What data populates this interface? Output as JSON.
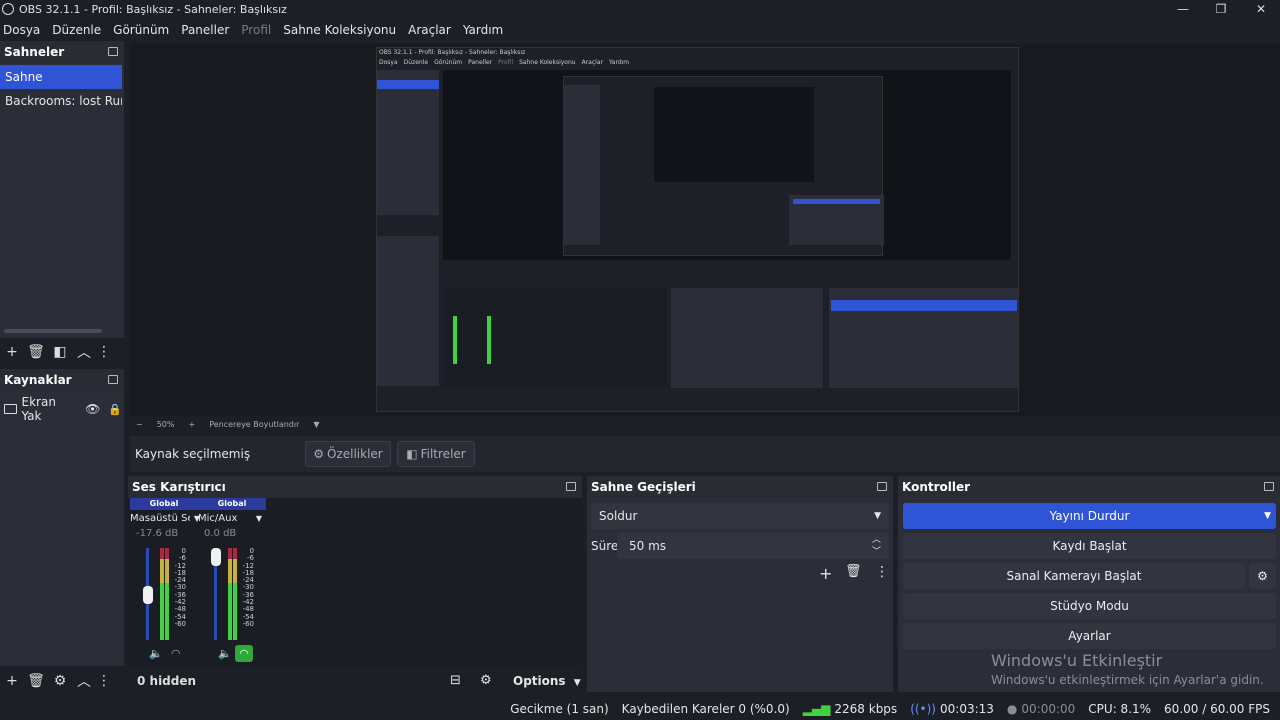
{
  "window": {
    "title": "OBS 32.1.1 - Profil: Başlıksız - Sahneler: Başlıksız"
  },
  "menu": [
    "Dosya",
    "Düzenle",
    "Görünüm",
    "Paneller",
    "Profil",
    "Sahne Koleksiyonu",
    "Araçlar",
    "Yardım"
  ],
  "scenes": {
    "title": "Sahneler",
    "items": [
      "Sahne",
      "Backrooms: lost Runne"
    ]
  },
  "sources": {
    "title": "Kaynaklar",
    "items": [
      "Ekran Yak"
    ]
  },
  "preview": {
    "zoom": "50%",
    "fit_label": "Pencereye Boyutlandır",
    "nested_title": "OBS 32.1.1 - Profil: Başlıksız - Sahneler: Başlıksız",
    "nested_menu": [
      "Dosya",
      "Düzenle",
      "Görünüm",
      "Paneller",
      "Profil",
      "Sahne Koleksiyonu",
      "Araçlar",
      "Yardım"
    ]
  },
  "context": {
    "no_source": "Kaynak seçilmemiş",
    "properties": "Özellikler",
    "filters": "Filtreler"
  },
  "mixer": {
    "title": "Ses Karıştırıcı",
    "channels": [
      {
        "scope": "Global",
        "name": "Masaüstü Ses",
        "db": "-17.6 dB"
      },
      {
        "scope": "Global",
        "name": "Mic/Aux",
        "db": "0.0 dB"
      }
    ],
    "scale": [
      "0",
      "-6",
      "-12",
      "-18",
      "-24",
      "-30",
      "-36",
      "-42",
      "-48",
      "-54",
      "-60"
    ],
    "hidden": "0 hidden",
    "options": "Options"
  },
  "transitions": {
    "title": "Sahne Geçişleri",
    "selected": "Soldur",
    "duration_label": "Süre",
    "duration_value": "50 ms"
  },
  "controls": {
    "title": "Kontroller",
    "buttons": [
      "Yayını Durdur",
      "Kaydı Başlat",
      "Sanal Kamerayı Başlat",
      "Stüdyo Modu",
      "Ayarlar"
    ]
  },
  "watermark": {
    "line1": "Windows'u Etkinleştir",
    "line2": "Windows'u etkinleştirmek için Ayarlar'a gidin."
  },
  "status": {
    "delay": "Gecikme (1 san)",
    "dropped": "Kaybedilen Kareler 0 (%0.0)",
    "bitrate": "2268 kbps",
    "stream_time": "00:03:13",
    "rec_time": "00:00:00",
    "cpu": "CPU: 8.1%",
    "fps": "60.00 / 60.00 FPS"
  },
  "colors": {
    "accent": "#2f54d6",
    "meter_green": "#3fd43f",
    "meter_yellow": "#c8b33a",
    "meter_red": "#b0263e"
  }
}
